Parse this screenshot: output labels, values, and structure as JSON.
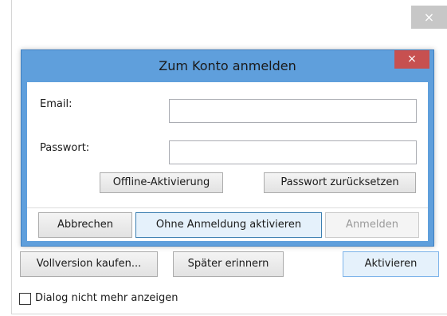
{
  "outer_dialog": {
    "close_glyph": "×",
    "buttons": {
      "buy": "Vollversion kaufen...",
      "remind": "Später erinnern",
      "activate": "Aktivieren"
    },
    "checkbox": {
      "label": "Dialog nicht mehr anzeigen",
      "checked": false
    }
  },
  "login_dialog": {
    "title": "Zum Konto anmelden",
    "close_glyph": "×",
    "email_label": "Email:",
    "email_value": "",
    "password_label": "Passwort:",
    "password_value": "",
    "buttons": {
      "offline": "Offline-Aktivierung",
      "reset": "Passwort zurücksetzen",
      "cancel": "Abbrechen",
      "no_login": "Ohne Anmeldung aktivieren",
      "login": "Anmelden"
    }
  },
  "colors": {
    "dialog_frame": "#5f9fdc",
    "close_red": "#c75050",
    "accent_button": "#e5f1fb"
  }
}
